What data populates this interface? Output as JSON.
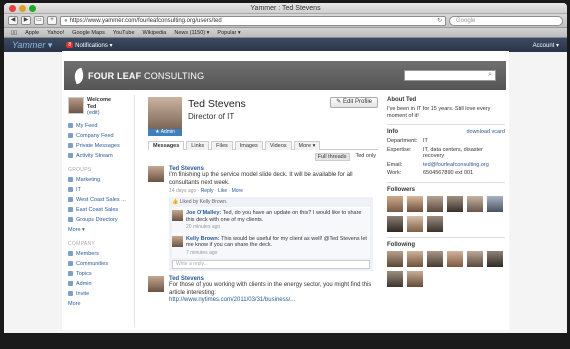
{
  "browser": {
    "window_title": "Yammer : Ted Stevens",
    "url": "https://www.yammer.com/fourleafconsulting.org/users/ted",
    "search_placeholder": "Google",
    "bookmarks": [
      "Apple",
      "Yahoo!",
      "Google Maps",
      "YouTube",
      "Wikipedia",
      "News (1150) ▾",
      "Popular ▾"
    ]
  },
  "topbar": {
    "logo": "Yammer ▾",
    "notifications_label": "Notifications ▾",
    "notifications_count": "8",
    "account_label": "Account ▾"
  },
  "banner": {
    "brand_bold": "FOUR LEAF",
    "brand_rest": " CONSULTING"
  },
  "sidebar": {
    "welcome": "Welcome",
    "user": "Ted",
    "edit": "(edit)",
    "nav": [
      "My Feed",
      "Company Feed",
      "Private Messages",
      "Activity Stream"
    ],
    "groups_heading": "GROUPS",
    "groups": [
      "Marketing",
      "IT",
      "West Coast Sales ...",
      "East Coast Sales",
      "Groups Directory"
    ],
    "groups_more": "More ▾",
    "company_heading": "COMPANY",
    "company": [
      "Members",
      "Communities",
      "Topics",
      "Admin",
      "Invite"
    ],
    "company_more": "More"
  },
  "profile": {
    "name": "Ted Stevens",
    "title": "Director of IT",
    "admin_badge": "Admin",
    "edit_button": "Edit Profile",
    "tabs": [
      "Messages",
      "Links",
      "Files",
      "Images",
      "Videos",
      "More ▾"
    ],
    "filter_full": "Full threads",
    "filter_only": "Ted only"
  },
  "feed": {
    "m1_author": "Ted Stevens",
    "m1_body": "I'm finishing up the service model slide deck. It will be available for all consultants next week.",
    "m1_meta_time": "14 days ago · ",
    "m1_meta_reply": "Reply",
    "m1_meta_like": "Like",
    "m1_meta_more": "More",
    "m1_likes": "Liked by Kelly Brown.",
    "r1_author": "Joe O'Malley:",
    "r1_body": " Ted, do you have an update on this? I would like to share this deck with one of my clients.",
    "r1_time": "20 minutes ago",
    "r2_author": "Kelly Brown:",
    "r2_body": " This would be useful for my client as well! @Ted Stevens let me know if you can share the deck.",
    "r2_time": "7 minutes ago",
    "reply_placeholder": "Write a reply...",
    "m2_author": "Ted Stevens",
    "m2_body": "For those of you working with clients in the energy sector, you might find this article interesting:",
    "m2_link": "http://www.nytimes.com/2011/03/31/business/..."
  },
  "right": {
    "about_heading": "About Ted",
    "about_text": "I've been in IT for 15 years. Still love every moment of it!",
    "info_heading": "Info",
    "vcard": "download vcard",
    "department_label": "Department:",
    "department": "IT",
    "expertise_label": "Expertise:",
    "expertise": "IT, data centers, disaster recovery",
    "email_label": "Email:",
    "email": "ted@fourleafconsulting.org",
    "work_label": "Work:",
    "work": "6504567890 ext 001",
    "followers_heading": "Followers",
    "following_heading": "Following"
  },
  "colors": {
    "accent": "#2a5b9a",
    "topbar": "#2f3a4f",
    "banner": "#5f5f5f",
    "admin": "#3e7fbf"
  }
}
